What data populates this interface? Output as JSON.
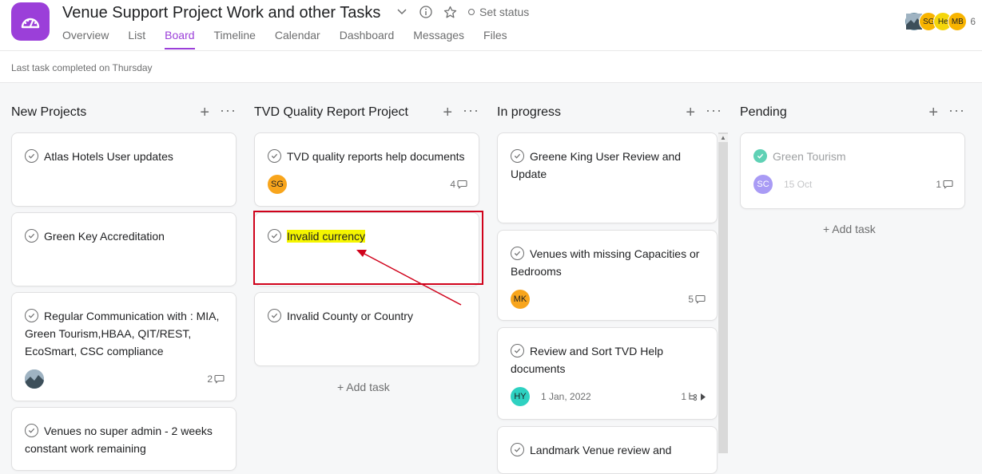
{
  "header": {
    "title": "Venue Support Project Work and other Tasks",
    "set_status": "Set status",
    "tabs": [
      {
        "label": "Overview",
        "active": false
      },
      {
        "label": "List",
        "active": false
      },
      {
        "label": "Board",
        "active": true
      },
      {
        "label": "Timeline",
        "active": false
      },
      {
        "label": "Calendar",
        "active": false
      },
      {
        "label": "Dashboard",
        "active": false
      },
      {
        "label": "Messages",
        "active": false
      },
      {
        "label": "Files",
        "active": false
      }
    ],
    "members": [
      {
        "initials": "",
        "color": "#6b8fa3",
        "kind": "photo"
      },
      {
        "initials": "SG",
        "color": "#f8b400"
      },
      {
        "initials": "He",
        "color": "#f5d60a"
      },
      {
        "initials": "MB",
        "color": "#f8b400"
      }
    ],
    "member_count": "6"
  },
  "subbar": {
    "last_completed": "Last task completed on Thursday"
  },
  "columns": [
    {
      "title": "New Projects",
      "cards": [
        {
          "title": "Atlas Hotels User updates"
        },
        {
          "title": "Green Key Accreditation"
        },
        {
          "title": "Regular Communication with : MIA, Green Tourism,HBAA, QIT/REST, EcoSmart, CSC compliance",
          "assignee_kind": "photo",
          "comments": "2"
        },
        {
          "title": "Venues no super admin - 2 weeks constant work remaining"
        }
      ]
    },
    {
      "title": "TVD Quality Report Project",
      "cards": [
        {
          "title": "TVD quality reports help documents",
          "assignee": "SG",
          "assignee_color": "#f8a51c",
          "comments": "4"
        },
        {
          "title": "Invalid currency",
          "highlighted": true
        },
        {
          "title": "Invalid County or Country"
        }
      ],
      "add_task": "+ Add task"
    },
    {
      "title": "In progress",
      "cards": [
        {
          "title": "Greene King User Review and Update"
        },
        {
          "title": "Venues with missing Capacities or Bedrooms",
          "assignee": "MK",
          "assignee_color": "#f8a51c",
          "comments": "5"
        },
        {
          "title": "Review and Sort TVD Help documents",
          "assignee": "HY",
          "assignee_color": "#2ed1c1",
          "date": "1 Jan, 2022",
          "subtasks": "1"
        },
        {
          "title": "Landmark Venue review and"
        }
      ]
    },
    {
      "title": "Pending",
      "cards": [
        {
          "title": "Green Tourism",
          "completed": true,
          "assignee": "SC",
          "assignee_color": "#a99bf5",
          "date": "15 Oct",
          "comments": "1"
        }
      ],
      "add_task": "+ Add task"
    }
  ],
  "colors": {
    "accent": "#9b3fd9",
    "annotation": "#d0021b",
    "highlight": "#f5f500"
  }
}
